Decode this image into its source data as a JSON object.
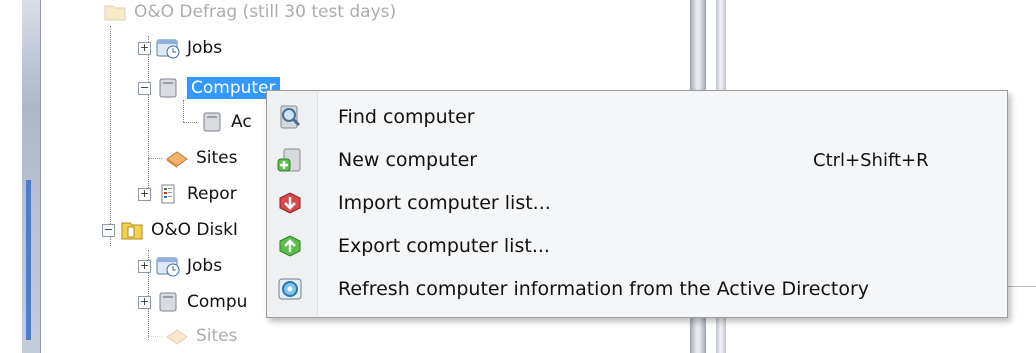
{
  "tree": {
    "top_item": "O&O Defrag (still 30 test days)",
    "group1": [
      {
        "label": "Jobs",
        "icon": "jobs-icon"
      },
      {
        "label": "Computer",
        "icon": "computer-icon",
        "selected": true
      },
      {
        "label": "Ac",
        "icon": "computer-icon"
      },
      {
        "label": "Sites",
        "icon": "sites-icon"
      },
      {
        "label": "Repor",
        "icon": "reports-icon"
      }
    ],
    "product2": "O&O DiskI",
    "group2": [
      {
        "label": "Jobs",
        "icon": "jobs-icon"
      },
      {
        "label": "Compu",
        "icon": "computer-icon"
      },
      {
        "label": "Sites",
        "icon": "sites-icon"
      }
    ]
  },
  "context_menu": {
    "items": [
      {
        "label": "Find computer",
        "icon": "find-computer-icon",
        "shortcut": ""
      },
      {
        "label": "New computer",
        "icon": "new-computer-icon",
        "shortcut": "Ctrl+Shift+R"
      },
      {
        "label": "Import computer list...",
        "icon": "import-list-icon",
        "shortcut": ""
      },
      {
        "label": "Export computer list...",
        "icon": "export-list-icon",
        "shortcut": ""
      },
      {
        "label": "Refresh computer information from the Active Directory",
        "icon": "refresh-ad-icon",
        "shortcut": ""
      }
    ]
  },
  "colors": {
    "selection": "#3399ff",
    "menu_bg": "#f5f6f7",
    "accent": "#4a7fd0"
  }
}
